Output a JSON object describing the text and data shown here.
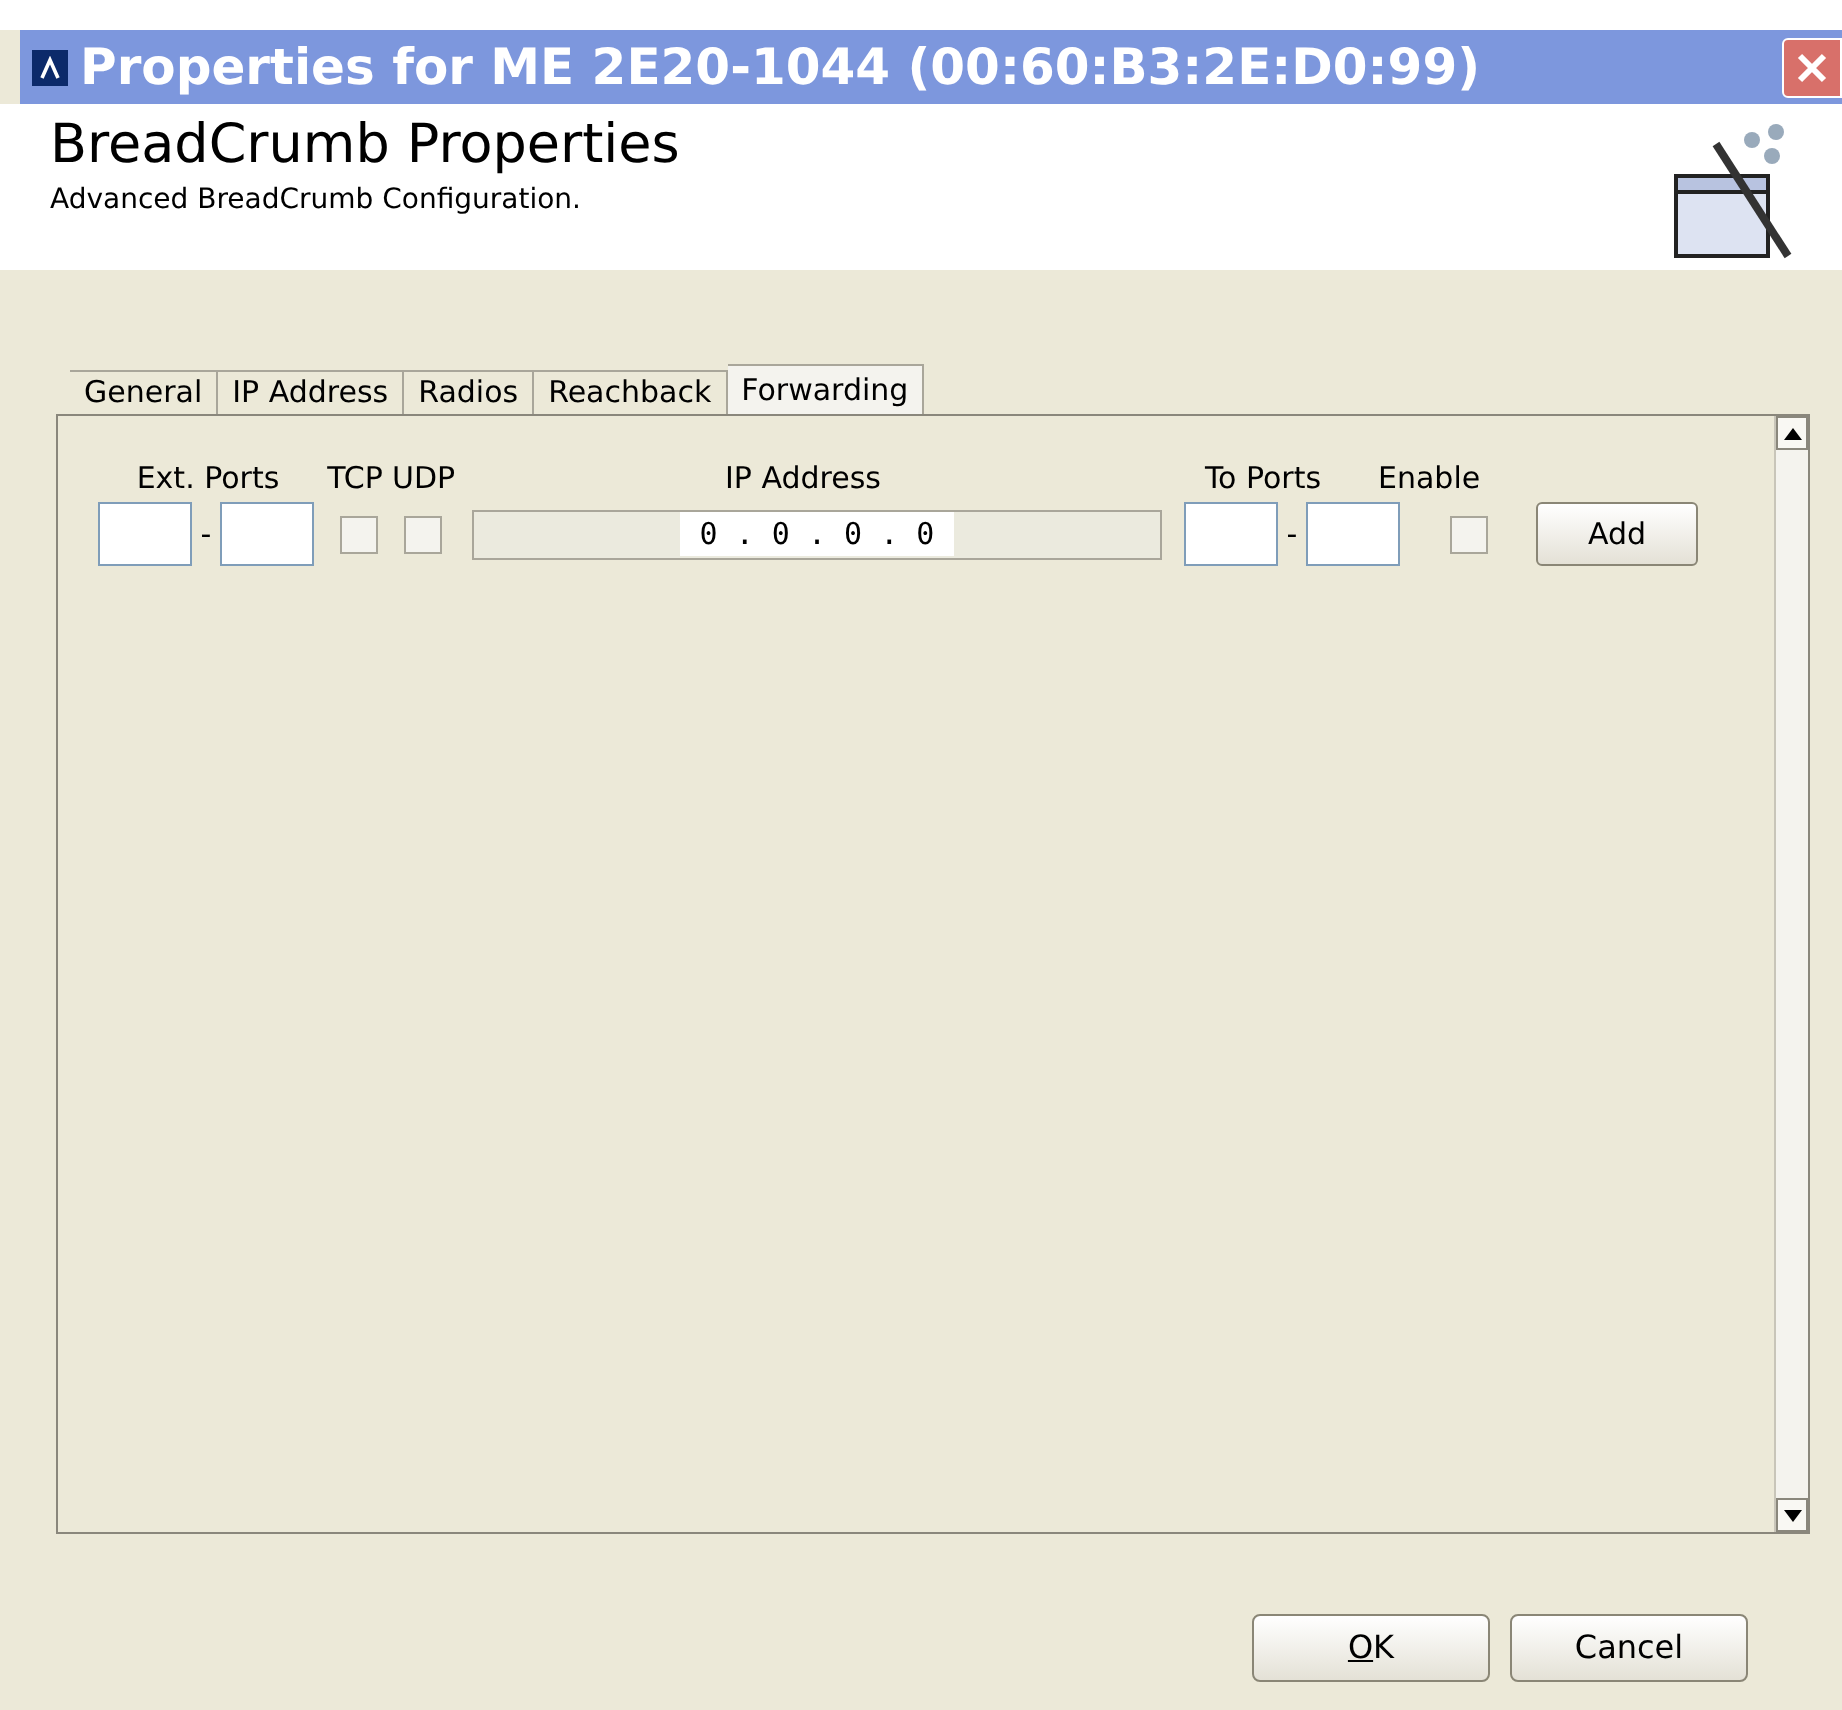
{
  "window": {
    "title": "Properties for ME 2E20-1044 (00:60:B3:2E:D0:99)"
  },
  "header": {
    "title": "BreadCrumb Properties",
    "subtitle": "Advanced BreadCrumb Configuration."
  },
  "tabs": [
    {
      "label": "General",
      "selected": false
    },
    {
      "label": "IP Address",
      "selected": false
    },
    {
      "label": "Radios",
      "selected": false
    },
    {
      "label": "Reachback",
      "selected": false
    },
    {
      "label": "Forwarding",
      "selected": true
    }
  ],
  "forwarding": {
    "columns": [
      "Ext. Ports",
      "TCP",
      "UDP",
      "IP Address",
      "To Ports",
      "Enable"
    ],
    "row": {
      "separator_1": "-",
      "tcp": {
        "checked": false
      },
      "udp": {
        "checked": false
      },
      "ip_address": "0 . 0 . 0 . 0",
      "to_port_separator": "-",
      "enable": {
        "checked": false
      },
      "add_button": "Add"
    }
  },
  "buttons": [
    {
      "label": "OK",
      "underline_first": true
    },
    {
      "label": "Cancel",
      "underline_first": false
    }
  ]
}
